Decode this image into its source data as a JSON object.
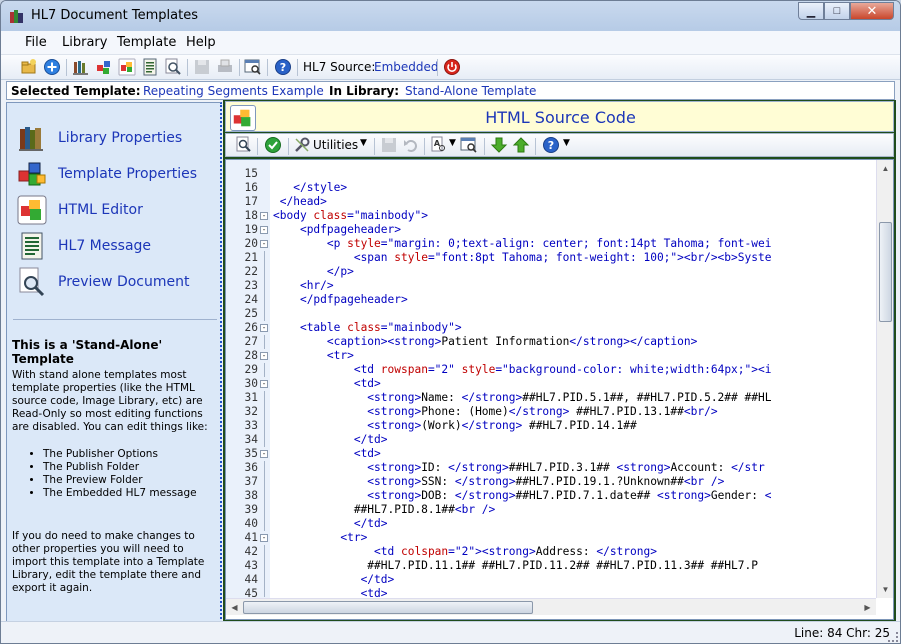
{
  "window": {
    "title": "HL7 Document Templates"
  },
  "menu": [
    "File",
    "Library",
    "Template",
    "Help"
  ],
  "toolbar": {
    "source_label": "HL7 Source:",
    "source_value": "Embedded"
  },
  "info": {
    "selected_label": "Selected Template:",
    "selected_value": "Repeating Segments Example",
    "library_label": "In Library:",
    "library_value": "Stand-Alone Template"
  },
  "sidebar": {
    "items": [
      {
        "label": "Library Properties",
        "icon": "books-icon"
      },
      {
        "label": "Template Properties",
        "icon": "blocks-icon"
      },
      {
        "label": "HTML Editor",
        "icon": "cubes-icon"
      },
      {
        "label": "HL7 Message",
        "icon": "document-lines-icon"
      },
      {
        "label": "Preview Document",
        "icon": "magnifier-document-icon"
      }
    ],
    "title": "This is a 'Stand-Alone' Template",
    "para1": "With stand alone templates most template properties (like the HTML source code, Image Library, etc) are Read-Only so most editing functions are disabled. You can edit things like:",
    "bullets": [
      "The Publisher Options",
      "The Publish Folder",
      "The Preview Folder",
      "The Embedded HL7 message"
    ],
    "para2": "If you do need to make changes to other properties you will need to import this template into a Template Library, edit the template there and export it again."
  },
  "editor": {
    "header_title": "HTML Source Code",
    "utilities_label": "Utilities",
    "lines": [
      {
        "n": "15",
        "fold": "",
        "segs": []
      },
      {
        "n": "16",
        "fold": "",
        "segs": [
          [
            "x",
            "   "
          ],
          [
            "t",
            "</style>"
          ]
        ]
      },
      {
        "n": "17",
        "fold": "",
        "segs": [
          [
            "x",
            " "
          ],
          [
            "t",
            "</head>"
          ]
        ]
      },
      {
        "n": "18",
        "fold": "-",
        "segs": [
          [
            "t",
            "<body "
          ],
          [
            "a",
            "class"
          ],
          [
            "t",
            "=\"mainbody\">"
          ]
        ]
      },
      {
        "n": "19",
        "fold": "-",
        "segs": [
          [
            "x",
            "    "
          ],
          [
            "t",
            "<pdfpageheader>"
          ]
        ]
      },
      {
        "n": "20",
        "fold": "-",
        "segs": [
          [
            "x",
            "        "
          ],
          [
            "t",
            "<p "
          ],
          [
            "a",
            "style"
          ],
          [
            "t",
            "=\"margin: 0;text-align: center; font:14pt Tahoma; font-wei"
          ]
        ]
      },
      {
        "n": "21",
        "fold": "",
        "segs": [
          [
            "x",
            "            "
          ],
          [
            "t",
            "<span "
          ],
          [
            "a",
            "style"
          ],
          [
            "t",
            "=\"font:8pt Tahoma; font-weight: 100;\"><br/><b>Syste"
          ]
        ]
      },
      {
        "n": "22",
        "fold": "",
        "segs": [
          [
            "x",
            "        "
          ],
          [
            "t",
            "</p>"
          ]
        ]
      },
      {
        "n": "23",
        "fold": "",
        "segs": [
          [
            "x",
            "    "
          ],
          [
            "t",
            "<hr/>"
          ]
        ]
      },
      {
        "n": "24",
        "fold": "",
        "segs": [
          [
            "x",
            "    "
          ],
          [
            "t",
            "</pdfpageheader>"
          ]
        ]
      },
      {
        "n": "25",
        "fold": "",
        "segs": []
      },
      {
        "n": "26",
        "fold": "-",
        "segs": [
          [
            "x",
            "    "
          ],
          [
            "t",
            "<table "
          ],
          [
            "a",
            "class"
          ],
          [
            "t",
            "=\"mainbody\">"
          ]
        ]
      },
      {
        "n": "27",
        "fold": "",
        "segs": [
          [
            "x",
            "        "
          ],
          [
            "t",
            "<caption><strong>"
          ],
          [
            "x",
            "Patient Information"
          ],
          [
            "t",
            "</strong></caption>"
          ]
        ]
      },
      {
        "n": "28",
        "fold": "-",
        "segs": [
          [
            "x",
            "        "
          ],
          [
            "t",
            "<tr>"
          ]
        ]
      },
      {
        "n": "29",
        "fold": "",
        "segs": [
          [
            "x",
            "            "
          ],
          [
            "t",
            "<td "
          ],
          [
            "a",
            "rowspan"
          ],
          [
            "t",
            "=\"2\" "
          ],
          [
            "a",
            "style"
          ],
          [
            "t",
            "=\"background-color: white;width:64px;\"><i"
          ]
        ]
      },
      {
        "n": "30",
        "fold": "-",
        "segs": [
          [
            "x",
            "            "
          ],
          [
            "t",
            "<td>"
          ]
        ]
      },
      {
        "n": "31",
        "fold": "",
        "segs": [
          [
            "x",
            "              "
          ],
          [
            "t",
            "<strong>"
          ],
          [
            "x",
            "Name: "
          ],
          [
            "t",
            "</strong>"
          ],
          [
            "x",
            "##HL7.PID.5.1##, ##HL7.PID.5.2## ##HL"
          ]
        ]
      },
      {
        "n": "32",
        "fold": "",
        "segs": [
          [
            "x",
            "              "
          ],
          [
            "t",
            "<strong>"
          ],
          [
            "x",
            "Phone: (Home)"
          ],
          [
            "t",
            "</strong>"
          ],
          [
            "x",
            " ##HL7.PID.13.1##"
          ],
          [
            "t",
            "<br/>"
          ]
        ]
      },
      {
        "n": "33",
        "fold": "",
        "segs": [
          [
            "x",
            "              "
          ],
          [
            "t",
            "<strong>"
          ],
          [
            "x",
            "(Work)"
          ],
          [
            "t",
            "</strong>"
          ],
          [
            "x",
            " ##HL7.PID.14.1##"
          ]
        ]
      },
      {
        "n": "34",
        "fold": "",
        "segs": [
          [
            "x",
            "            "
          ],
          [
            "t",
            "</td>"
          ]
        ]
      },
      {
        "n": "35",
        "fold": "-",
        "segs": [
          [
            "x",
            "            "
          ],
          [
            "t",
            "<td>"
          ]
        ]
      },
      {
        "n": "36",
        "fold": "",
        "segs": [
          [
            "x",
            "              "
          ],
          [
            "t",
            "<strong>"
          ],
          [
            "x",
            "ID: "
          ],
          [
            "t",
            "</strong>"
          ],
          [
            "x",
            "##HL7.PID.3.1## "
          ],
          [
            "t",
            "<strong>"
          ],
          [
            "x",
            "Account: "
          ],
          [
            "t",
            "</str"
          ]
        ]
      },
      {
        "n": "37",
        "fold": "",
        "segs": [
          [
            "x",
            "              "
          ],
          [
            "t",
            "<strong>"
          ],
          [
            "x",
            "SSN: "
          ],
          [
            "t",
            "</strong>"
          ],
          [
            "x",
            "##HL7.PID.19.1.?Unknown##"
          ],
          [
            "t",
            "<br />"
          ]
        ]
      },
      {
        "n": "38",
        "fold": "",
        "segs": [
          [
            "x",
            "              "
          ],
          [
            "t",
            "<strong>"
          ],
          [
            "x",
            "DOB: "
          ],
          [
            "t",
            "</strong>"
          ],
          [
            "x",
            "##HL7.PID.7.1.date## "
          ],
          [
            "t",
            "<strong>"
          ],
          [
            "x",
            "Gender: "
          ],
          [
            "t",
            "<"
          ]
        ]
      },
      {
        "n": "39",
        "fold": "",
        "segs": [
          [
            "x",
            "            ##HL7.PID.8.1##"
          ],
          [
            "t",
            "<br />"
          ]
        ]
      },
      {
        "n": "40",
        "fold": "",
        "segs": [
          [
            "x",
            "            "
          ],
          [
            "t",
            "</td>"
          ]
        ]
      },
      {
        "n": "41",
        "fold": "-",
        "segs": [
          [
            "x",
            "          "
          ],
          [
            "t",
            "<tr>"
          ]
        ]
      },
      {
        "n": "42",
        "fold": "",
        "segs": [
          [
            "x",
            "               "
          ],
          [
            "t",
            "<td "
          ],
          [
            "a",
            "colspan"
          ],
          [
            "t",
            "=\"2\"><strong>"
          ],
          [
            "x",
            "Address: "
          ],
          [
            "t",
            "</strong>"
          ]
        ]
      },
      {
        "n": "43",
        "fold": "",
        "segs": [
          [
            "x",
            "              ##HL7.PID.11.1## ##HL7.PID.11.2## ##HL7.PID.11.3## ##HL7.P"
          ]
        ]
      },
      {
        "n": "44",
        "fold": "",
        "segs": [
          [
            "x",
            "             "
          ],
          [
            "t",
            "</td>"
          ]
        ]
      },
      {
        "n": "45",
        "fold": "",
        "segs": [
          [
            "x",
            "             "
          ],
          [
            "t",
            "<td>"
          ]
        ]
      }
    ]
  },
  "status": {
    "text": "Line: 84 Chr: 25"
  }
}
